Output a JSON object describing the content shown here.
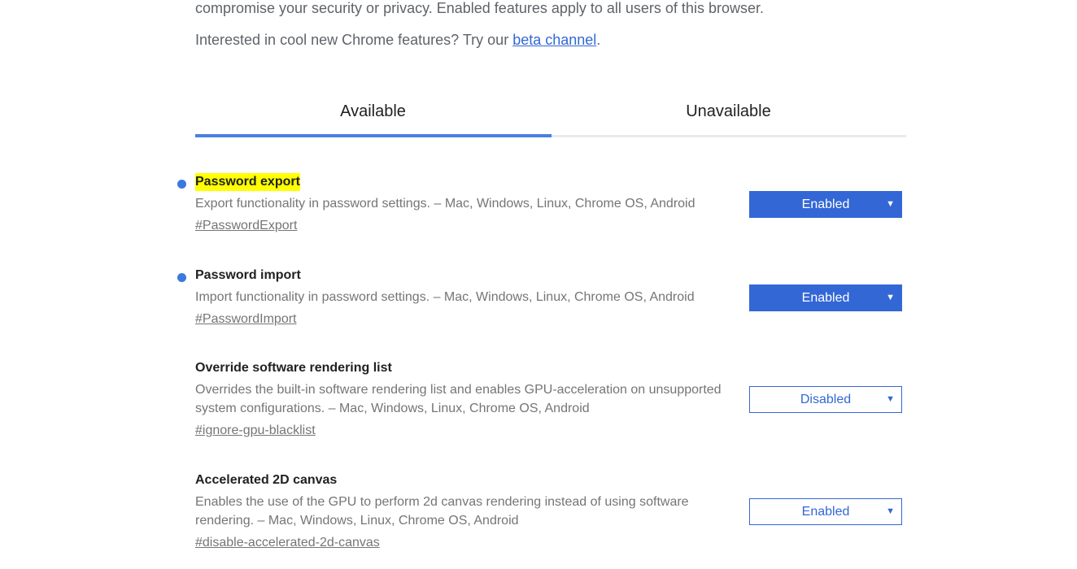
{
  "intro": {
    "line1": "compromise your security or privacy. Enabled features apply to all users of this browser.",
    "line2_prefix": "Interested in cool new Chrome features? Try our ",
    "line2_link": "beta channel",
    "line2_suffix": "."
  },
  "tabs": {
    "available": "Available",
    "unavailable": "Unavailable"
  },
  "experiments": [
    {
      "name": "Password export",
      "description": "Export functionality in password settings. – Mac, Windows, Linux, Chrome OS, Android",
      "link": "#PasswordExport",
      "select": "Enabled"
    },
    {
      "name": "Password import",
      "description": "Import functionality in password settings. – Mac, Windows, Linux, Chrome OS, Android",
      "link": "#PasswordImport",
      "select": "Enabled"
    },
    {
      "name": "Override software rendering list",
      "description": "Overrides the built-in software rendering list and enables GPU-acceleration on unsupported system configurations. – Mac, Windows, Linux, Chrome OS, Android",
      "link": "#ignore-gpu-blacklist",
      "select": "Disabled"
    },
    {
      "name": "Accelerated 2D canvas",
      "description": "Enables the use of the GPU to perform 2d canvas rendering instead of using software rendering. – Mac, Windows, Linux, Chrome OS, Android",
      "link": "#disable-accelerated-2d-canvas",
      "select": "Enabled"
    }
  ],
  "select_arrow": "▼",
  "colors": {
    "accent": "#3367d6",
    "highlight": "#ffff00",
    "modified_dot": "#3c78e0"
  }
}
